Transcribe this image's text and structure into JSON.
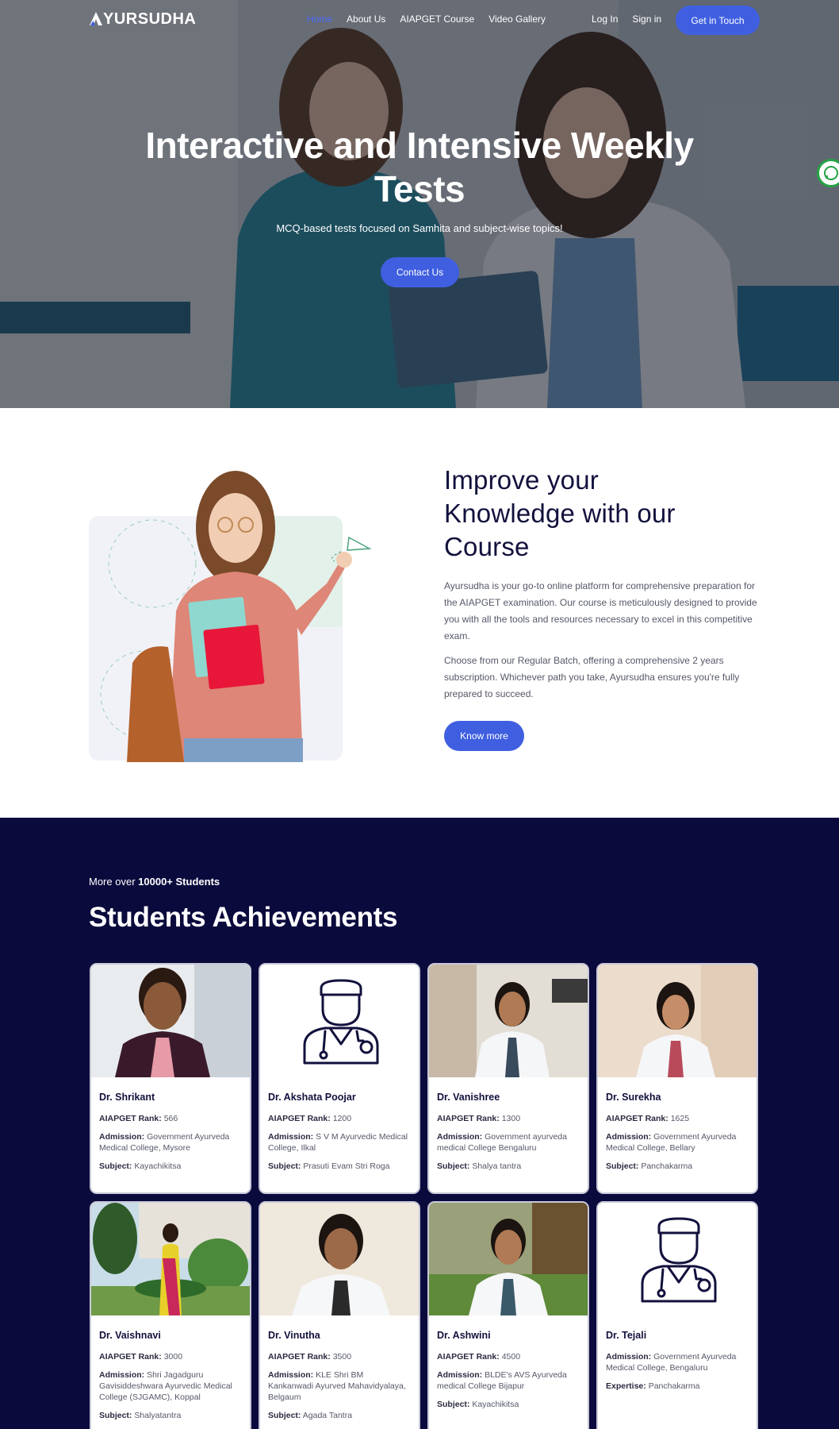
{
  "brand": {
    "logo_text": "YURSUDHA"
  },
  "nav": {
    "links": [
      "Home",
      "About Us",
      "AIAPGET Course",
      "Video Gallery"
    ],
    "login": "Log In",
    "signin": "Sign in",
    "cta": "Get in Touch"
  },
  "hero": {
    "title_line1": "Interactive and Intensive Weekly",
    "title_line2": "Tests",
    "subtitle": "MCQ-based tests focused on Samhita and subject-wise topics!",
    "button": "Contact Us"
  },
  "course": {
    "title_line1": "Improve your",
    "title_line2": "Knowledge with our",
    "title_line3": "Course",
    "para1": "Ayursudha is your go-to online platform for comprehensive preparation for the AIAPGET examination. Our course is meticulously designed to provide you with all the tools and resources necessary to excel in this competitive exam.",
    "para2": "Choose from our Regular Batch, offering a comprehensive 2 years subscription. Whichever path you take, Ayursudha ensures you're fully prepared to succeed.",
    "button": "Know more"
  },
  "achievements": {
    "over_prefix": "More over",
    "over_count": "10000+ Students",
    "title": "Students Achievements",
    "labels": {
      "rank": "AIAPGET Rank:",
      "admission": "Admission:",
      "subject": "Subject:",
      "expertise": "Expertise:"
    },
    "students": [
      {
        "name": "Dr. Shrikant",
        "rank": "566",
        "admission": "Government Ayurveda Medical College, Mysore",
        "subject": "Kayachikitsa"
      },
      {
        "name": "Dr. Akshata Poojar",
        "rank": "1200",
        "admission": "S V M Ayurvedic Medical College, Ilkal",
        "subject": "Prasuti Evam Stri Roga"
      },
      {
        "name": "Dr. Vanishree",
        "rank": "1300",
        "admission": "Government ayurveda medical College Bengaluru",
        "subject": "Shalya tantra"
      },
      {
        "name": "Dr. Surekha",
        "rank": "1625",
        "admission": "Government Ayurveda Medical College, Bellary",
        "subject": "Panchakarma"
      },
      {
        "name": "Dr. Vaishnavi",
        "rank": "3000",
        "admission": "Shri Jagadguru Gavisiddeshwara Ayurvedic Medical College (SJGAMC), Koppal",
        "subject": "Shalyatantra"
      },
      {
        "name": "Dr. Vinutha",
        "rank": "3500",
        "admission": "KLE Shri BM Kankanwadi Ayurved Mahavidyalaya, Belgaum",
        "subject": "Agada Tantra"
      },
      {
        "name": "Dr. Ashwini",
        "rank": "4500",
        "admission": "BLDE's AVS Ayurveda medical College Bijapur",
        "subject": "Kayachikitsa"
      },
      {
        "name": "Dr. Tejali",
        "admission": "Government Ayurveda Medical College, Bengaluru",
        "expertise": "Panchakarma"
      }
    ]
  },
  "colors": {
    "accent": "#3f5fe0",
    "navy": "#0b0a3d",
    "active_link": "#4d6bff",
    "whatsapp": "#25a244"
  },
  "icons": {
    "doctor_placeholder": "doctor-icon",
    "whatsapp": "whatsapp-icon",
    "paper_plane": "paper-plane-icon"
  }
}
